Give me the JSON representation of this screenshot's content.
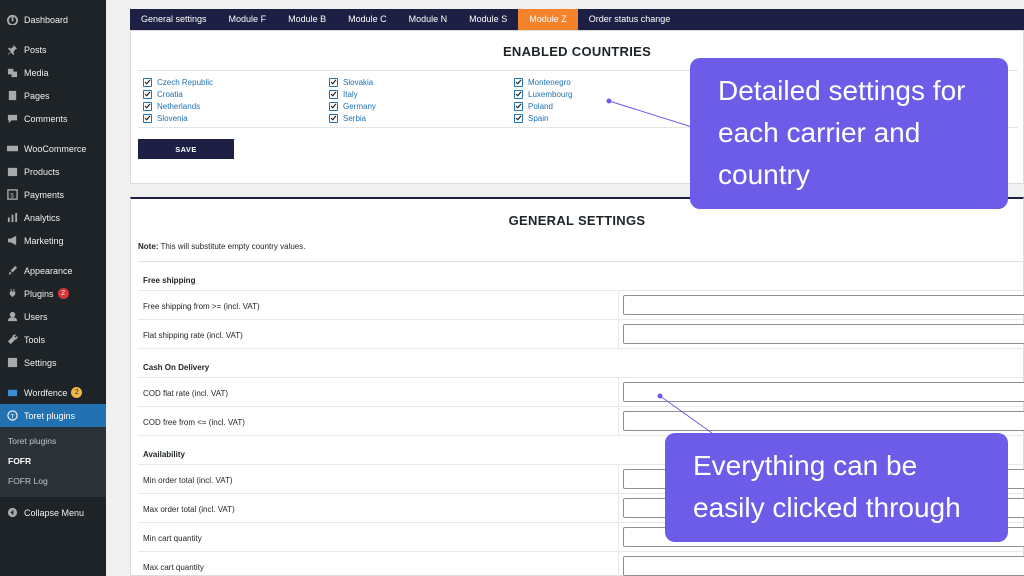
{
  "sidebar": {
    "items": [
      {
        "label": "Dashboard",
        "icon": "dashboard-icon"
      },
      {
        "label": "Posts",
        "icon": "pin-icon"
      },
      {
        "label": "Media",
        "icon": "media-icon"
      },
      {
        "label": "Pages",
        "icon": "page-icon"
      },
      {
        "label": "Comments",
        "icon": "comment-icon"
      },
      {
        "label": "WooCommerce",
        "icon": "woo-icon"
      },
      {
        "label": "Products",
        "icon": "products-icon"
      },
      {
        "label": "Payments",
        "icon": "payments-icon"
      },
      {
        "label": "Analytics",
        "icon": "analytics-icon"
      },
      {
        "label": "Marketing",
        "icon": "megaphone-icon"
      },
      {
        "label": "Appearance",
        "icon": "brush-icon"
      },
      {
        "label": "Plugins",
        "icon": "plugin-icon",
        "badge": "2"
      },
      {
        "label": "Users",
        "icon": "user-icon"
      },
      {
        "label": "Tools",
        "icon": "wrench-icon"
      },
      {
        "label": "Settings",
        "icon": "settings-icon"
      },
      {
        "label": "Wordfence",
        "icon": "wordfence-icon",
        "badge": "2"
      },
      {
        "label": "Toret plugins",
        "icon": "toret-icon"
      }
    ],
    "submenu": [
      "Toret plugins",
      "FOFR",
      "FOFR Log"
    ],
    "collapse": "Collapse Menu"
  },
  "tabs": [
    "General settings",
    "Module F",
    "Module B",
    "Module C",
    "Module N",
    "Module S",
    "Module Z",
    "Order status change"
  ],
  "active_tab": "Module Z",
  "enabled_countries": {
    "title": "ENABLED COUNTRIES",
    "columns": [
      [
        "Czech Republic",
        "Croatia",
        "Netherlands",
        "Slovenia"
      ],
      [
        "Slovakia",
        "Italy",
        "Germany",
        "Serbia"
      ],
      [
        "Montenegro",
        "Luxembourg",
        "Poland",
        "Spain"
      ]
    ],
    "save_label": "SAVE"
  },
  "general_settings": {
    "title": "GENERAL SETTINGS",
    "note_bold": "Note:",
    "note_text": " This will substitute empty country values.",
    "rows": [
      {
        "type": "section",
        "label": "Free shipping"
      },
      {
        "type": "field",
        "label": "Free shipping from >= (incl. VAT)",
        "value": ""
      },
      {
        "type": "field",
        "label": "Flat shipping rate (incl. VAT)",
        "value": ""
      },
      {
        "type": "section",
        "label": "Cash On Delivery"
      },
      {
        "type": "field",
        "label": "COD flat rate (incl. VAT)",
        "value": ""
      },
      {
        "type": "field",
        "label": "COD free from <= (incl. VAT)",
        "value": ""
      },
      {
        "type": "section",
        "label": "Availability"
      },
      {
        "type": "field",
        "label": "Min order total (incl. VAT)",
        "value": ""
      },
      {
        "type": "field",
        "label": "Max order total (incl. VAT)",
        "value": ""
      },
      {
        "type": "field",
        "label": "Min cart quantity",
        "value": ""
      },
      {
        "type": "field",
        "label": "Max cart quantity",
        "value": ""
      }
    ]
  },
  "callouts": {
    "first": "Detailed settings for each carrier and country",
    "second": "Everything can be easily clicked through"
  },
  "colors": {
    "sidebar_bg": "#1d2327",
    "active_blue": "#2271b1",
    "tab_bar": "#1d2044",
    "tab_active": "#f4832c",
    "callout": "#6c5ce7"
  }
}
